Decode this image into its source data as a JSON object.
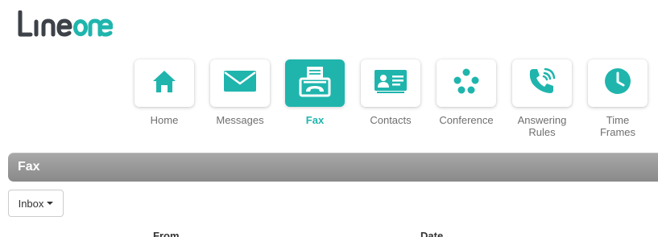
{
  "brand": {
    "logo_text": "LINEONE",
    "accent_color": "#1fb5ad",
    "logo_dark": "#3d4148"
  },
  "nav": {
    "items": [
      {
        "label": "Home",
        "icon": "home-icon",
        "active": false
      },
      {
        "label": "Messages",
        "icon": "envelope-icon",
        "active": false
      },
      {
        "label": "Fax",
        "icon": "fax-icon",
        "active": true
      },
      {
        "label": "Contacts",
        "icon": "contact-card-icon",
        "active": false
      },
      {
        "label": "Conference",
        "icon": "conference-icon",
        "active": false
      },
      {
        "label": "Answering Rules",
        "icon": "phone-ringing-icon",
        "active": false
      },
      {
        "label": "Time Frames",
        "icon": "clock-icon",
        "active": false
      }
    ]
  },
  "section": {
    "title": "Fax"
  },
  "inbox": {
    "label": "Inbox"
  },
  "table": {
    "columns": [
      "From",
      "Date"
    ]
  }
}
